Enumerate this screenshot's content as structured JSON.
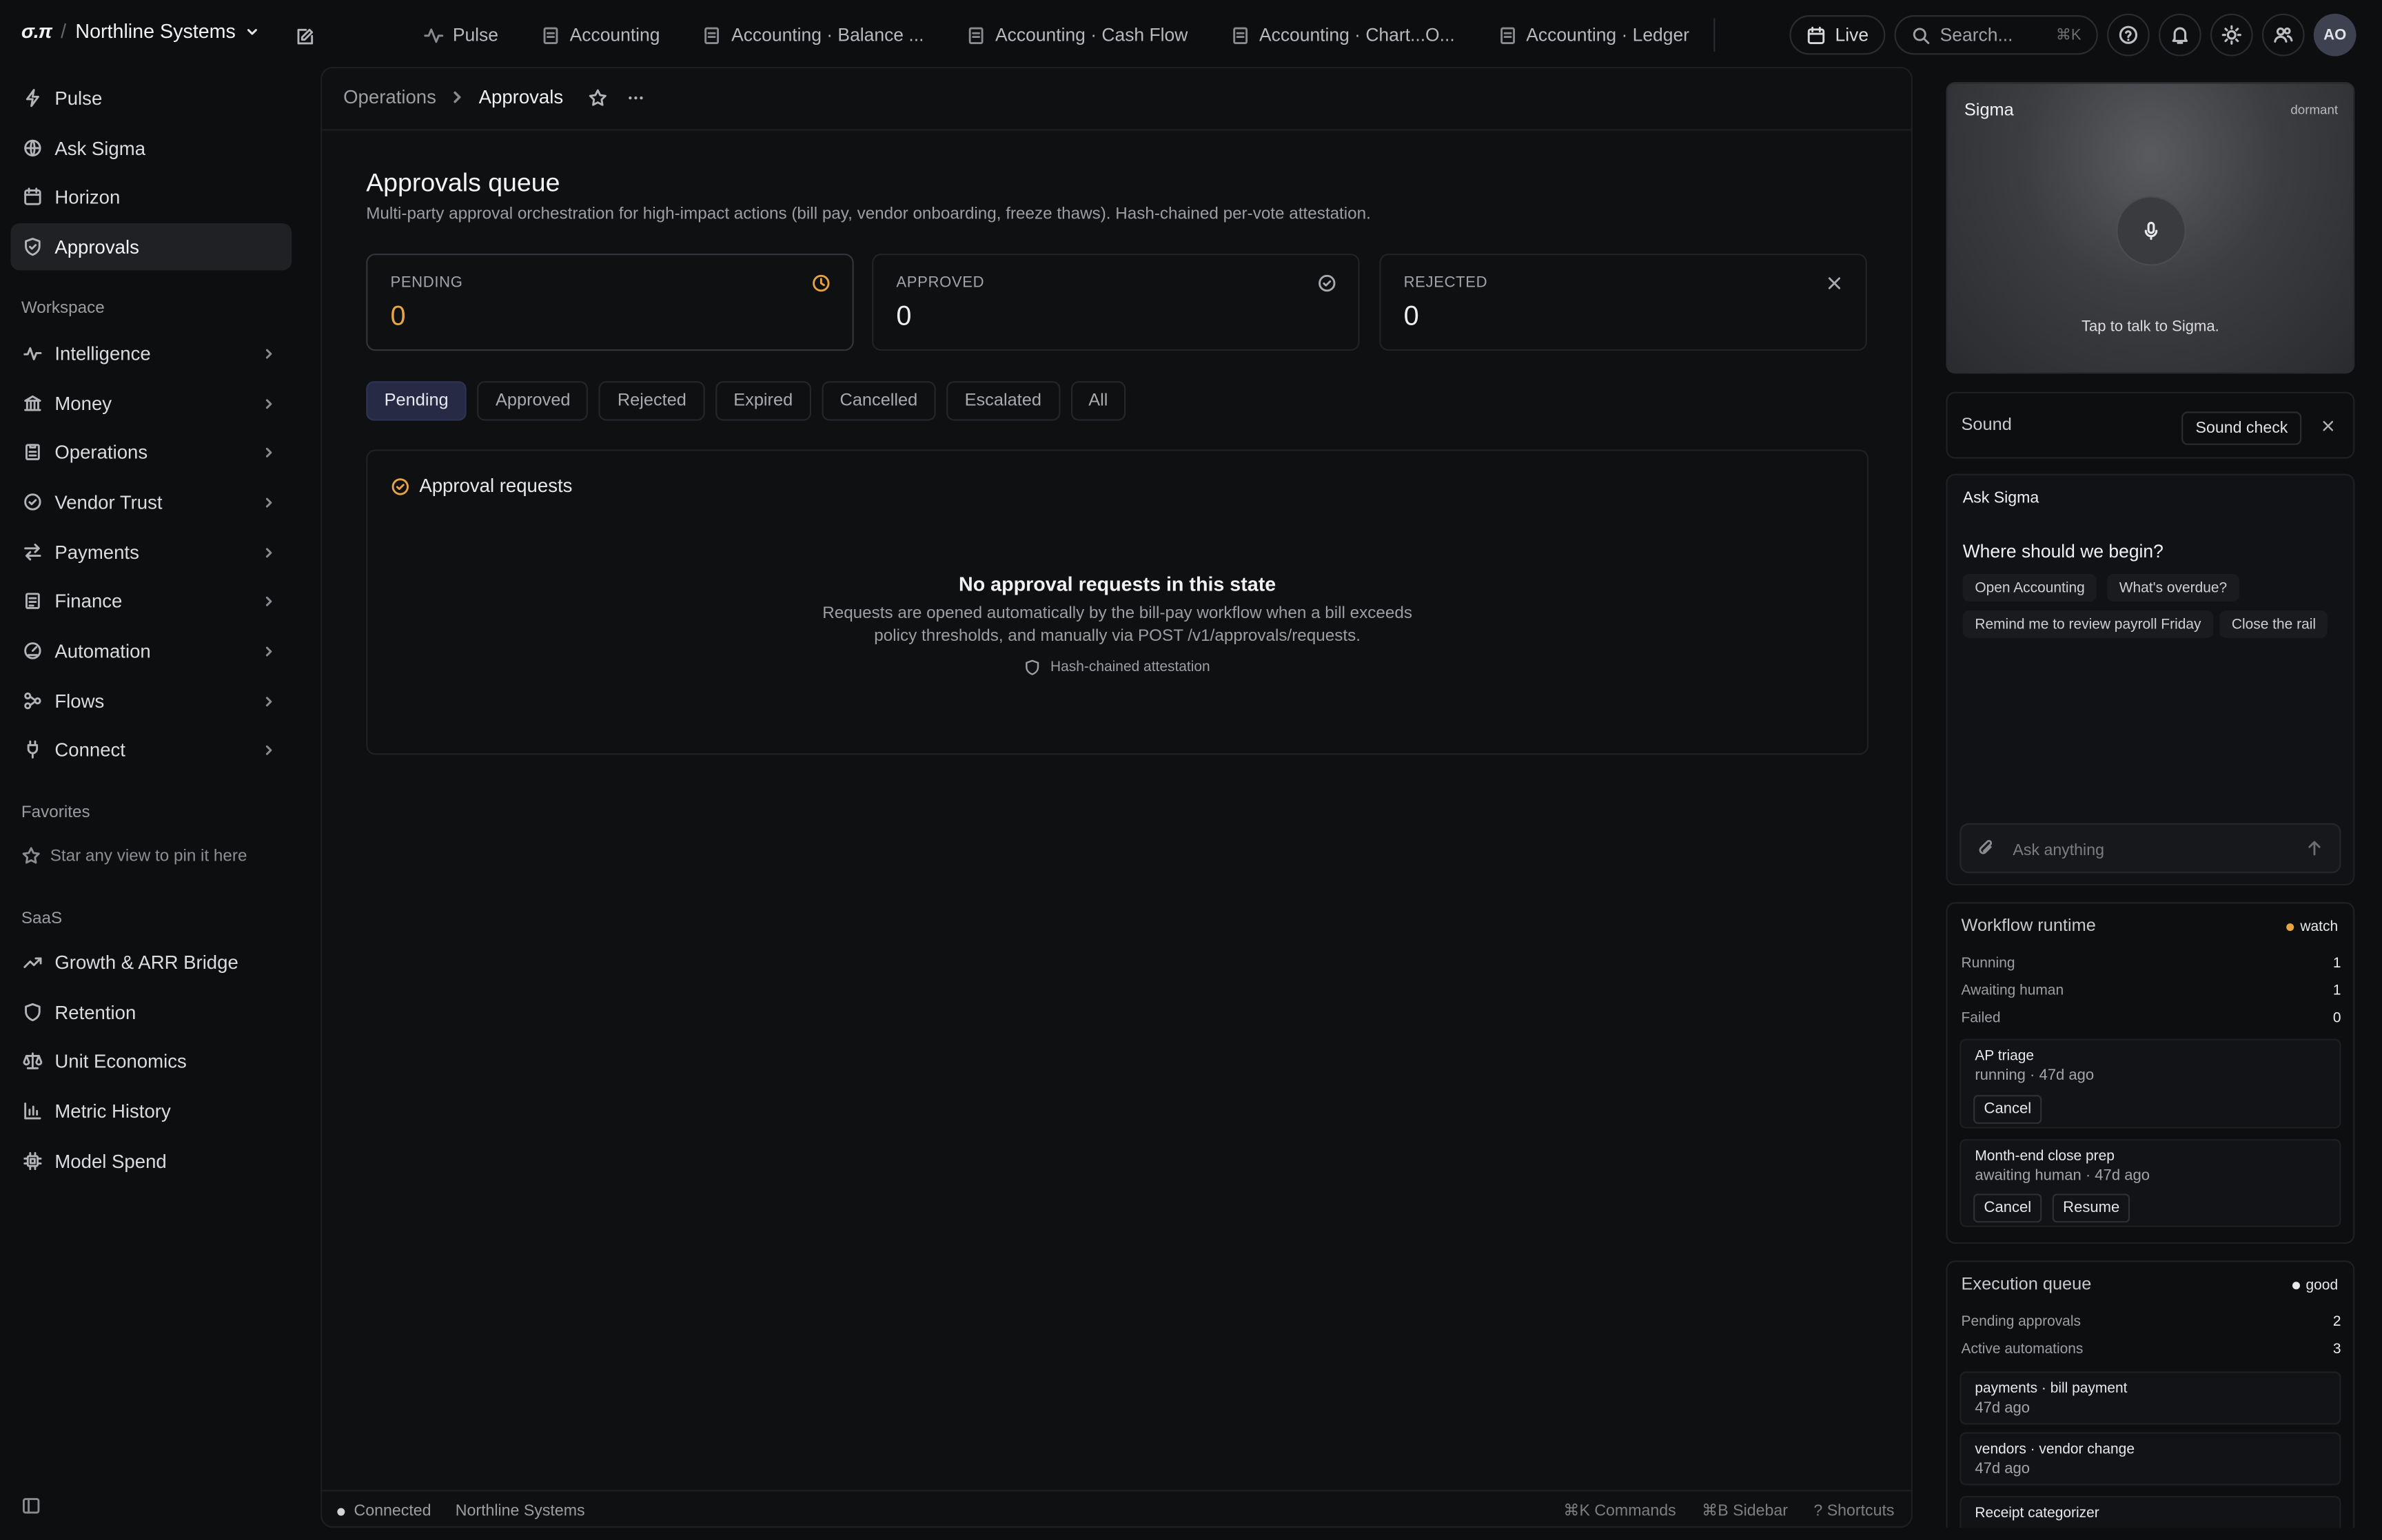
{
  "brand": {
    "logo": "σ.π",
    "separator": "/",
    "org": "Northline Systems"
  },
  "tabs": [
    {
      "label": "Pulse",
      "icon": "pulse-icon"
    },
    {
      "label": "Accounting",
      "icon": "doc-icon"
    },
    {
      "label": "Accounting · Balance ...",
      "icon": "doc-icon"
    },
    {
      "label": "Accounting · Cash Flow",
      "icon": "doc-icon"
    },
    {
      "label": "Accounting · Chart...O...",
      "icon": "doc-icon"
    },
    {
      "label": "Accounting · Ledger",
      "icon": "doc-icon"
    }
  ],
  "toolbar": {
    "live_label": "Live",
    "search_placeholder": "Search...",
    "search_shortcut": "⌘K",
    "avatar_initials": "AO"
  },
  "sidebar": {
    "top_items": [
      {
        "label": "Pulse",
        "icon": "pulse-icon"
      },
      {
        "label": "Ask Sigma",
        "icon": "globe-icon"
      },
      {
        "label": "Horizon",
        "icon": "calendar-icon"
      },
      {
        "label": "Approvals",
        "icon": "shield-icon",
        "active": true
      }
    ],
    "workspace_label": "Workspace",
    "workspace_items": [
      {
        "label": "Intelligence",
        "icon": "activity-icon"
      },
      {
        "label": "Money",
        "icon": "bank-icon"
      },
      {
        "label": "Operations",
        "icon": "clipboard-icon"
      },
      {
        "label": "Vendor Trust",
        "icon": "check-circle-icon"
      },
      {
        "label": "Payments",
        "icon": "transfer-icon"
      },
      {
        "label": "Finance",
        "icon": "clipboard-icon"
      },
      {
        "label": "Automation",
        "icon": "gauge-icon"
      },
      {
        "label": "Flows",
        "icon": "flows-icon"
      },
      {
        "label": "Connect",
        "icon": "plug-icon"
      }
    ],
    "favorites_label": "Favorites",
    "favorites_hint": "Star any view to pin it here",
    "saas_label": "SaaS",
    "saas_items": [
      {
        "label": "Growth & ARR Bridge",
        "icon": "trend-icon"
      },
      {
        "label": "Retention",
        "icon": "shield-icon"
      },
      {
        "label": "Unit Economics",
        "icon": "scale-icon"
      },
      {
        "label": "Metric History",
        "icon": "bar-chart-icon"
      },
      {
        "label": "Model Spend",
        "icon": "chip-icon"
      }
    ]
  },
  "breadcrumb": {
    "parent": "Operations",
    "current": "Approvals"
  },
  "page": {
    "title": "Approvals queue",
    "subtitle": "Multi-party approval orchestration for high-impact actions (bill pay, vendor onboarding, freeze thaws). Hash-chained per-vote attestation."
  },
  "stats": [
    {
      "label": "PENDING",
      "value": "0"
    },
    {
      "label": "APPROVED",
      "value": "0"
    },
    {
      "label": "REJECTED",
      "value": "0"
    }
  ],
  "filters": [
    "Pending",
    "Approved",
    "Rejected",
    "Expired",
    "Cancelled",
    "Escalated",
    "All"
  ],
  "requests": {
    "title": "Approval requests",
    "empty_title": "No approval requests in this state",
    "empty_line1": "Requests are opened automatically by the bill-pay workflow when a bill exceeds",
    "empty_line2": "policy thresholds, and manually via POST /v1/approvals/requests.",
    "attestation": "Hash-chained attestation"
  },
  "statusbar": {
    "connection": "Connected",
    "org": "Northline Systems",
    "commands": "⌘K Commands",
    "sidebar": "⌘B Sidebar",
    "shortcuts": "? Shortcuts"
  },
  "sigma": {
    "title": "Sigma",
    "state": "dormant",
    "hint": "Tap to talk to Sigma."
  },
  "sound": {
    "label": "Sound",
    "button": "Sound check"
  },
  "ask": {
    "title": "Ask Sigma",
    "prompt": "Where should we begin?",
    "chips": [
      "Open Accounting",
      "What's overdue?",
      "Remind me to review payroll Friday",
      "Close the rail"
    ],
    "placeholder": "Ask anything"
  },
  "workflow": {
    "title": "Workflow runtime",
    "badge": "watch",
    "badge_color": "#e6a443",
    "metrics": [
      {
        "label": "Running",
        "value": "1"
      },
      {
        "label": "Awaiting human",
        "value": "1"
      },
      {
        "label": "Failed",
        "value": "0"
      }
    ],
    "jobs": [
      {
        "name": "AP triage",
        "status": "running · 47d ago",
        "actions": [
          "Cancel"
        ]
      },
      {
        "name": "Month-end close prep",
        "status": "awaiting human · 47d ago",
        "actions": [
          "Cancel",
          "Resume"
        ]
      }
    ]
  },
  "execution": {
    "title": "Execution queue",
    "badge": "good",
    "badge_color": "#e9e9ec",
    "metrics": [
      {
        "label": "Pending approvals",
        "value": "2"
      },
      {
        "label": "Active automations",
        "value": "3"
      }
    ],
    "items": [
      {
        "name": "payments · bill payment",
        "status": "47d ago"
      },
      {
        "name": "vendors · vendor change",
        "status": "47d ago"
      },
      {
        "name": "Receipt categorizer",
        "status": ""
      }
    ]
  },
  "colors": {
    "accent_pending": "#e6a443",
    "active_filter_bg": "#262a44",
    "background": "#0d0e10"
  }
}
